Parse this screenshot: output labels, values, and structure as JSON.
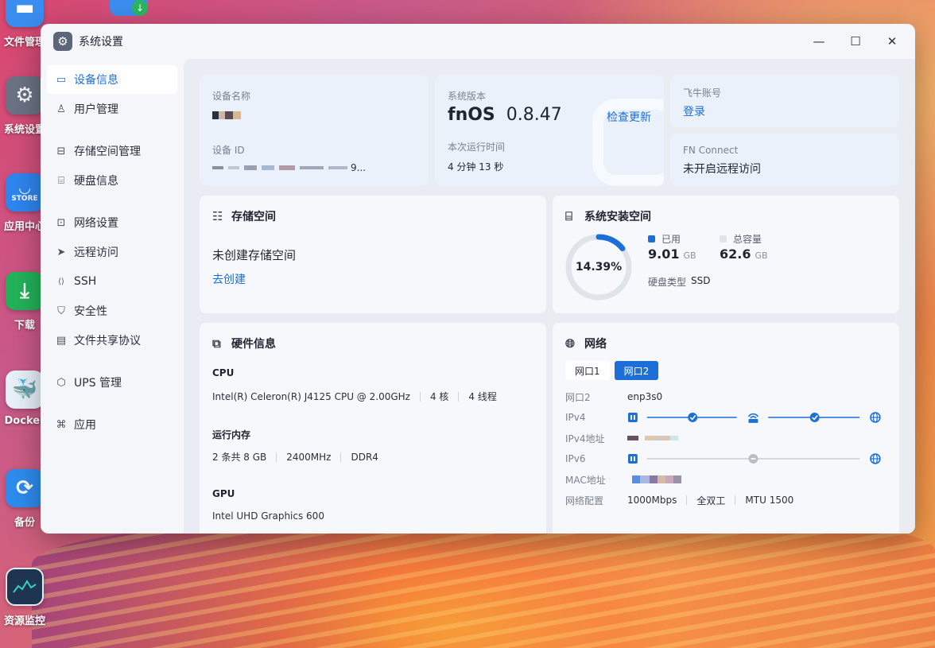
{
  "desktop": {
    "icons": [
      {
        "label": "文件管理"
      },
      {
        "label": "系统设置"
      },
      {
        "label": "应用中心",
        "tile_text": "STORE"
      },
      {
        "label": "下载"
      },
      {
        "label": "Docker"
      },
      {
        "label": "备份"
      },
      {
        "label": "资源监控"
      }
    ]
  },
  "window": {
    "title": "系统设置",
    "controls": {
      "minimize": "—",
      "maximize": "☐",
      "close": "✕"
    }
  },
  "sidebar": {
    "items": [
      {
        "label": "设备信息",
        "icon": "monitor-icon",
        "glyph": "▭"
      },
      {
        "label": "用户管理",
        "icon": "user-icon",
        "glyph": "♙"
      },
      {
        "label": "存储空间管理",
        "icon": "storage-icon",
        "glyph": "⊟"
      },
      {
        "label": "硬盘信息",
        "icon": "disk-icon",
        "glyph": "⌸"
      },
      {
        "label": "网络设置",
        "icon": "network-icon",
        "glyph": "⊡"
      },
      {
        "label": "远程访问",
        "icon": "send-icon",
        "glyph": "➤"
      },
      {
        "label": "SSH",
        "icon": "code-icon",
        "glyph": "⟨⟩"
      },
      {
        "label": "安全性",
        "icon": "shield-icon",
        "glyph": "⛉"
      },
      {
        "label": "文件共享协议",
        "icon": "file-icon",
        "glyph": "▤"
      },
      {
        "label": "UPS 管理",
        "icon": "shield-outline-icon",
        "glyph": "⬡"
      },
      {
        "label": "应用",
        "icon": "apps-icon",
        "glyph": "⌘"
      }
    ]
  },
  "device": {
    "name_label": "设备名称",
    "id_label": "设备 ID",
    "id_value_tail": "9..."
  },
  "system": {
    "version_label": "系统版本",
    "os_name": "fnOS",
    "version": "0.8.47",
    "check_update": "检查更新",
    "uptime_label": "本次运行时间",
    "uptime": "4 分钟 13 秒"
  },
  "account": {
    "label": "飞牛账号",
    "login": "登录",
    "fn_connect_label": "FN Connect",
    "fn_connect_value": "未开启远程访问"
  },
  "storage": {
    "title": "存储空间",
    "empty_text": "未创建存储空间",
    "create_link": "去创建"
  },
  "install_space": {
    "title": "系统安装空间",
    "percent_text": "14.39%",
    "percent_value": 14.39,
    "used_label": "已用",
    "used_value": "9.01",
    "used_unit": "GB",
    "total_label": "总容量",
    "total_value": "62.6",
    "total_unit": "GB",
    "disk_type_label": "硬盘类型",
    "disk_type": "SSD",
    "colors": {
      "used": "#1d6fd8",
      "track": "#dfe3ea"
    }
  },
  "hardware": {
    "title": "硬件信息",
    "cpu_head": "CPU",
    "cpu_model": "Intel(R) Celeron(R) J4125 CPU @ 2.00GHz",
    "cpu_cores": "4 核",
    "cpu_threads": "4 线程",
    "mem_head": "运行内存",
    "mem_size": "2 条共 8 GB",
    "mem_speed": "2400MHz",
    "mem_type": "DDR4",
    "gpu_head": "GPU",
    "gpu_model": "Intel UHD Graphics 600"
  },
  "network": {
    "title": "网络",
    "tabs": [
      {
        "label": "网口1"
      },
      {
        "label": "网口2",
        "active": true
      }
    ],
    "iface_label": "网口2",
    "iface_value": "enp3s0",
    "ipv4_label": "IPv4",
    "ipv4_addr_label": "IPv4地址",
    "ipv6_label": "IPv6",
    "mac_label": "MAC地址",
    "config_label": "网络配置",
    "speed": "1000Mbps",
    "duplex": "全双工",
    "mtu": "MTU 1500"
  }
}
